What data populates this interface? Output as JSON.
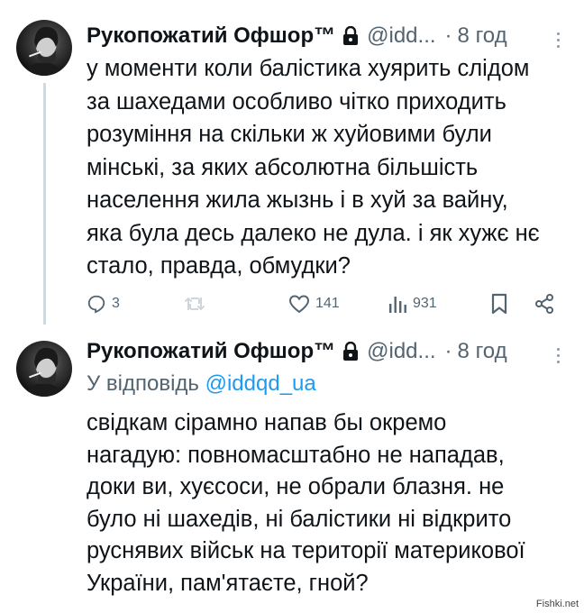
{
  "tweets": [
    {
      "author_name": "Рукопожатий Офшор™",
      "handle": "@idd...",
      "separator": "·",
      "time": "8 год",
      "text_lines": [
        "у моменти коли балістика хуярить слідом",
        "за шахедами особливо чітко приходить",
        "розуміння на скільки ж хуйовими були",
        "мінські, за яких абсолютна більшість",
        "населення жила жызнь і в хуй за вайну,",
        "яка була десь далеко не дула. і як хужє нє",
        "стало, правда, обмудки?"
      ],
      "actions": {
        "replies": "3",
        "retweets": "",
        "likes": "141",
        "views": "931"
      }
    },
    {
      "author_name": "Рукопожатий Офшор™",
      "handle": "@idd...",
      "separator": "·",
      "time": "8 год",
      "reply_prefix": "У відповідь",
      "reply_mention": "@iddqd_ua",
      "text_lines": [
        "свідкам сірамно напав бы окремо",
        "нагадую: повномасштабно не нападав,",
        "доки ви, хуєсоси, не обрали блазня. не",
        "було ні шахедів, ні балістики ні відкрито",
        "руснявих військ на території материкової",
        "України, пам'ятаєте, гной?"
      ]
    }
  ],
  "watermark": "Fishki.net"
}
